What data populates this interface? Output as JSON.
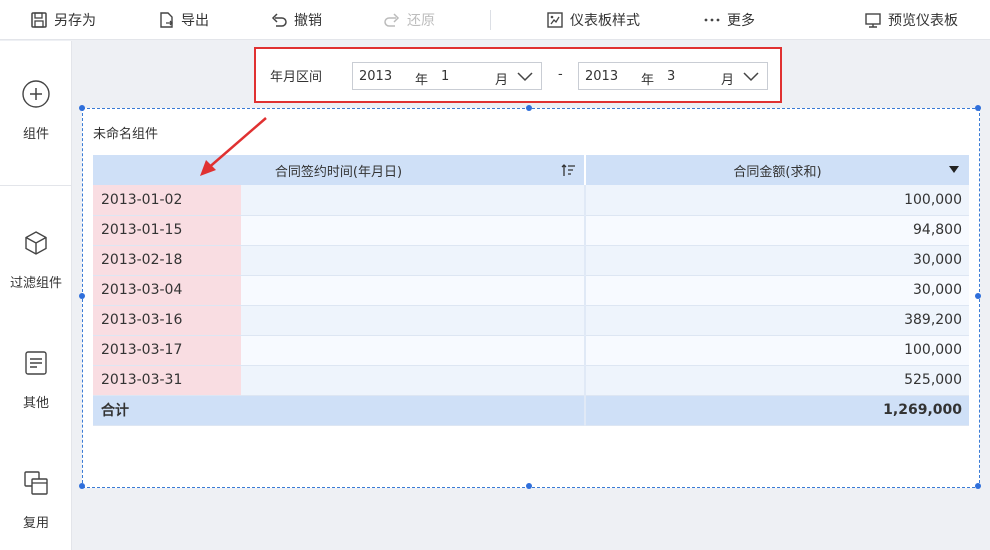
{
  "toolbar": {
    "save_as": "另存为",
    "export": "导出",
    "undo": "撤销",
    "redo": "还原",
    "dashboard_style": "仪表板样式",
    "more": "更多",
    "preview": "预览仪表板"
  },
  "sidebar": {
    "items": [
      {
        "label": "组件",
        "icon": "plus-circle-icon"
      },
      {
        "label": "过滤组件",
        "icon": "cube-icon"
      },
      {
        "label": "其他",
        "icon": "document-icon"
      },
      {
        "label": "复用",
        "icon": "reuse-icon"
      }
    ]
  },
  "filter": {
    "label": "年月区间",
    "separator": "-",
    "start": {
      "year": "2013",
      "year_unit": "年",
      "month": "1",
      "month_unit": "月"
    },
    "end": {
      "year": "2013",
      "year_unit": "年",
      "month": "3",
      "month_unit": "月"
    }
  },
  "widget": {
    "title": "未命名组件",
    "columns": [
      "合同签约时间(年月日)",
      "合同金额(求和)"
    ],
    "rows": [
      {
        "date": "2013-01-02",
        "amount": "100,000"
      },
      {
        "date": "2013-01-15",
        "amount": "94,800"
      },
      {
        "date": "2013-02-18",
        "amount": "30,000"
      },
      {
        "date": "2013-03-04",
        "amount": "30,000"
      },
      {
        "date": "2013-03-16",
        "amount": "389,200"
      },
      {
        "date": "2013-03-17",
        "amount": "100,000"
      },
      {
        "date": "2013-03-31",
        "amount": "525,000"
      }
    ],
    "total": {
      "label": "合计",
      "amount": "1,269,000"
    }
  },
  "colors": {
    "accent_blue": "#2f6fdb",
    "header_bg": "#cfe0f7",
    "highlight": "#f9dde2",
    "annotation_red": "#e03131"
  }
}
